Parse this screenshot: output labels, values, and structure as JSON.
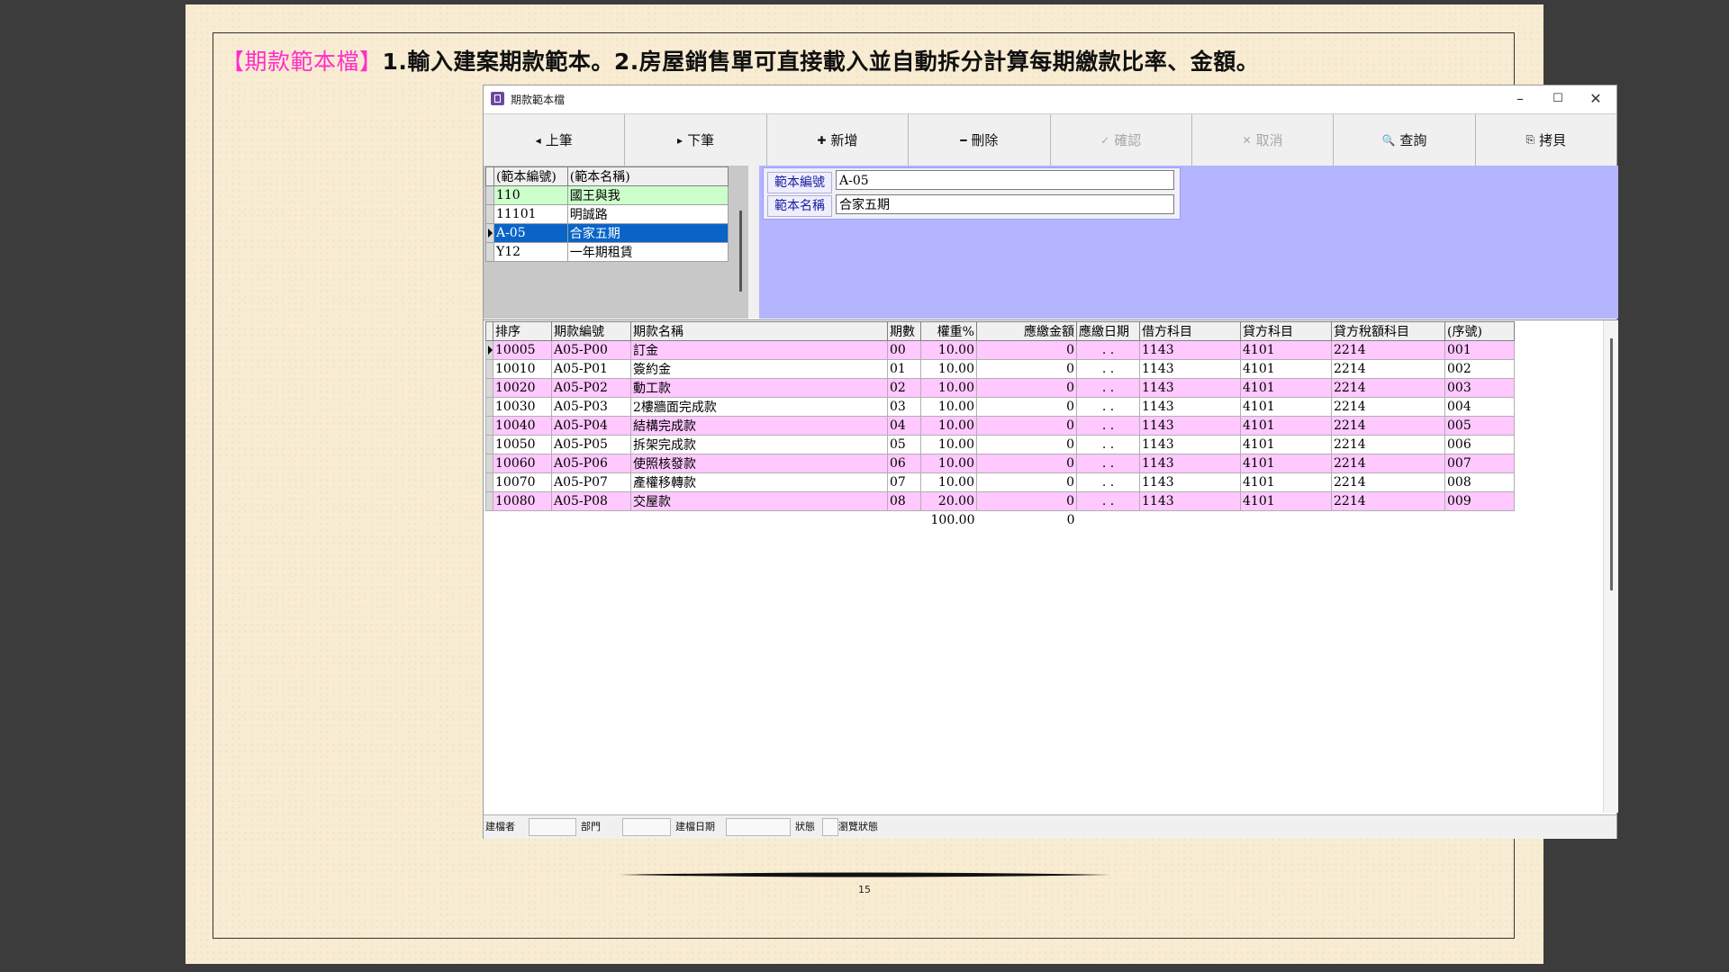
{
  "page": {
    "heading_tag": "【期款範本檔】",
    "heading_text": "1.輸入建案期款範本。2.房屋銷售單可直接載入並自動拆分計算每期繳款比率、金額。",
    "page_number": "15"
  },
  "window": {
    "title": "期款範本檔",
    "minimize": "–",
    "maximize": "☐",
    "close": "✕"
  },
  "toolbar": [
    {
      "icon": "◂",
      "label": "上筆",
      "enabled": true
    },
    {
      "icon": "▸",
      "label": "下筆",
      "enabled": true
    },
    {
      "icon": "✚",
      "label": "新增",
      "enabled": true
    },
    {
      "icon": "━",
      "label": "刪除",
      "enabled": true
    },
    {
      "icon": "✓",
      "label": "確認",
      "enabled": false
    },
    {
      "icon": "✕",
      "label": "取消",
      "enabled": false
    },
    {
      "icon": "🔍",
      "label": "查詢",
      "enabled": true
    },
    {
      "icon": "⎘",
      "label": "拷貝",
      "enabled": true
    }
  ],
  "template_list": {
    "headers": [
      "(範本編號)",
      "(範本名稱)"
    ],
    "rows": [
      {
        "id": "110",
        "name": "國王與我",
        "style": "green",
        "selected": false
      },
      {
        "id": "11101",
        "name": "明誠路",
        "style": "white",
        "selected": false
      },
      {
        "id": "A-05",
        "name": "合家五期",
        "style": "sel",
        "selected": true
      },
      {
        "id": "Y12",
        "name": "一年期租賃",
        "style": "white",
        "selected": false
      }
    ]
  },
  "form": {
    "template_no_label": "範本編號",
    "template_no_value": "A-05",
    "template_name_label": "範本名稱",
    "template_name_value": "合家五期"
  },
  "installments": {
    "headers": [
      "排序",
      "期款編號",
      "期款名稱",
      "期數",
      "權重%",
      "應繳金額",
      "應繳日期",
      "借方科目",
      "貸方科目",
      "貸方稅額科目",
      "(序號)"
    ],
    "rows": [
      [
        "10005",
        "A05-P00",
        "訂金",
        "00",
        "10.00",
        "0",
        " . .",
        "1143",
        "4101",
        "2214",
        "001"
      ],
      [
        "10010",
        "A05-P01",
        "簽約金",
        "01",
        "10.00",
        "0",
        " . .",
        "1143",
        "4101",
        "2214",
        "002"
      ],
      [
        "10020",
        "A05-P02",
        "動工款",
        "02",
        "10.00",
        "0",
        " . .",
        "1143",
        "4101",
        "2214",
        "003"
      ],
      [
        "10030",
        "A05-P03",
        "2樓牆面完成款",
        "03",
        "10.00",
        "0",
        " . .",
        "1143",
        "4101",
        "2214",
        "004"
      ],
      [
        "10040",
        "A05-P04",
        "結構完成款",
        "04",
        "10.00",
        "0",
        " . .",
        "1143",
        "4101",
        "2214",
        "005"
      ],
      [
        "10050",
        "A05-P05",
        "拆架完成款",
        "05",
        "10.00",
        "0",
        " . .",
        "1143",
        "4101",
        "2214",
        "006"
      ],
      [
        "10060",
        "A05-P06",
        "使照核發款",
        "06",
        "10.00",
        "0",
        " . .",
        "1143",
        "4101",
        "2214",
        "007"
      ],
      [
        "10070",
        "A05-P07",
        "產權移轉款",
        "07",
        "10.00",
        "0",
        " . .",
        "1143",
        "4101",
        "2214",
        "008"
      ],
      [
        "10080",
        "A05-P08",
        "交屋款",
        "08",
        "20.00",
        "0",
        " . .",
        "1143",
        "4101",
        "2214",
        "009"
      ]
    ],
    "total_weight": "100.00",
    "total_amount": "0"
  },
  "statusbar": {
    "creator_label": "建檔者",
    "dept_label": "部門",
    "date_label": "建檔日期",
    "status_label": "狀態",
    "browse_label": "瀏覽狀態"
  },
  "colors": {
    "magenta_tag": "#ff2ec8",
    "selected_row": "#0a64c8",
    "pink_row": "#ffc8ff",
    "green_row": "#ccffcc",
    "form_panel": "#b4b4ff"
  }
}
